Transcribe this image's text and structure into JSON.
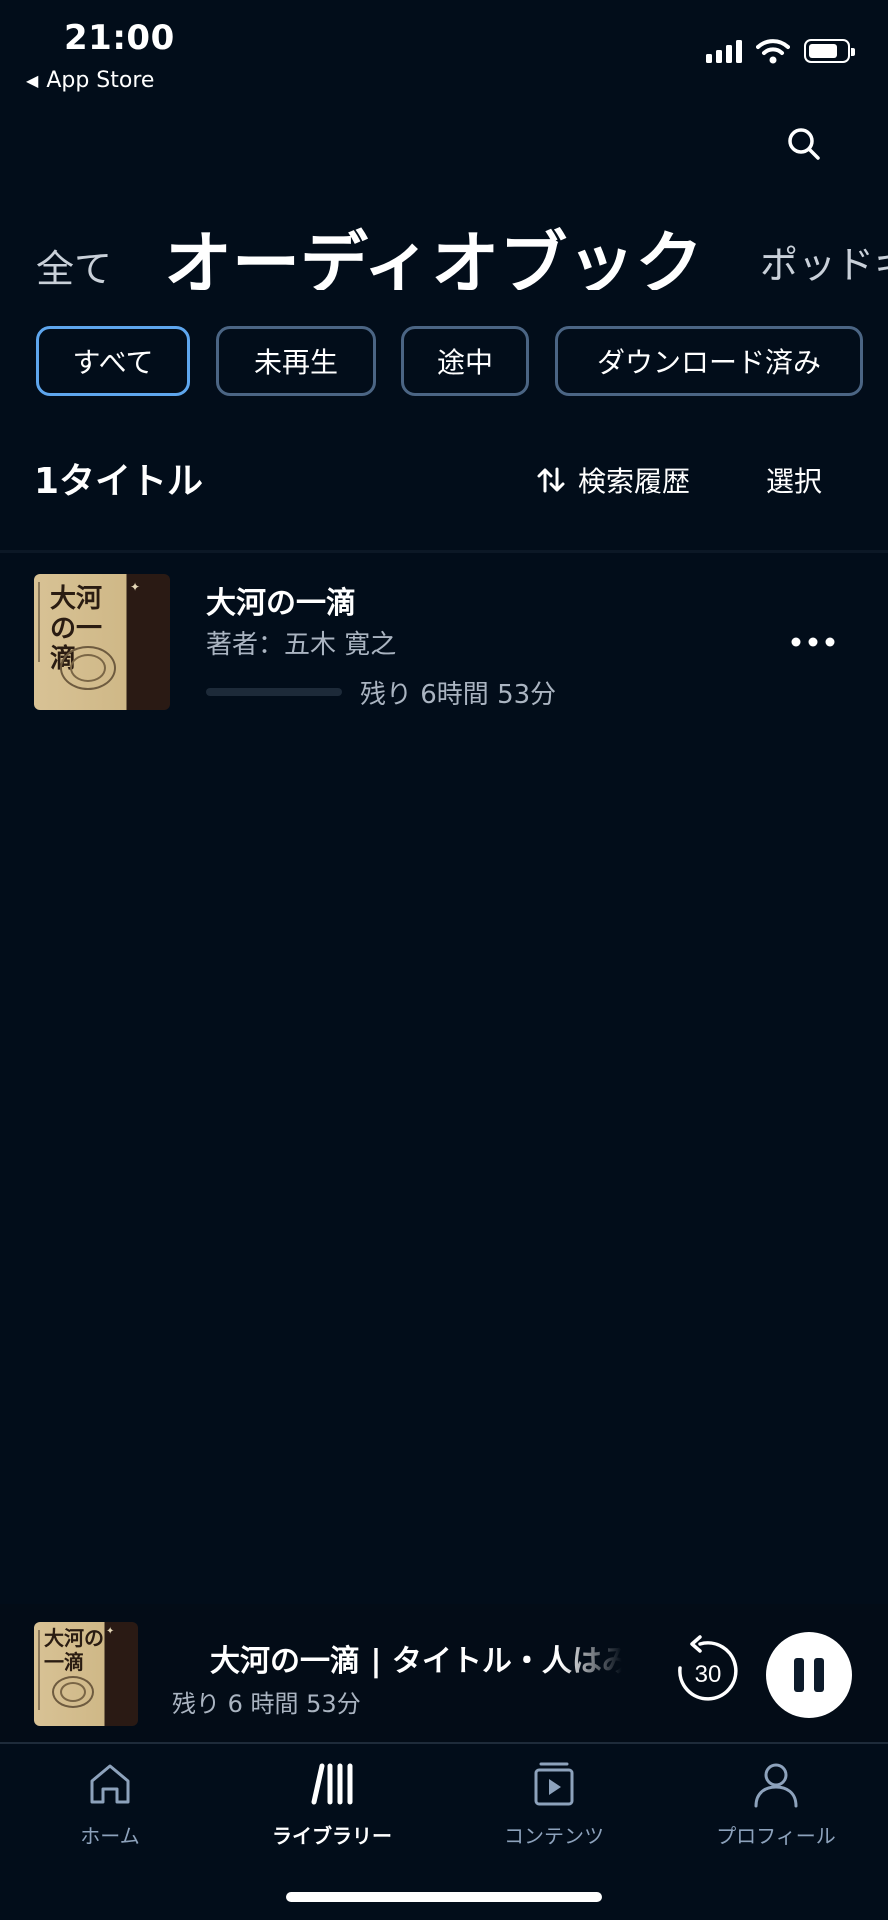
{
  "status_bar": {
    "time": "21:00",
    "back_app": "App Store"
  },
  "category_tabs": {
    "left": "全て",
    "active": "オーディオブック",
    "right": "ポッドキ"
  },
  "filters": [
    "すべて",
    "未再生",
    "途中",
    "ダウンロード済み"
  ],
  "active_filter": "すべて",
  "list_header": {
    "count": "1タイトル",
    "sort_label": "検索履歴",
    "select_label": "選択"
  },
  "books": [
    {
      "title": "大河の一滴",
      "author": "著者：五木 寛之",
      "remaining": "残り 6時間 53分",
      "cover_text": "大河の一滴"
    }
  ],
  "mini_player": {
    "title": "大河の一滴 | タイトル・人はみ",
    "subtitle": "残り 6 時間 53分",
    "skip_back_seconds": "30"
  },
  "tabs": [
    {
      "label": "ホーム",
      "icon": "home-icon"
    },
    {
      "label": "ライブラリー",
      "icon": "library-icon"
    },
    {
      "label": "コンテンツ",
      "icon": "content-icon"
    },
    {
      "label": "プロフィール",
      "icon": "profile-icon"
    }
  ],
  "active_tab": "ライブラリー",
  "colors": {
    "background": "#020d1a",
    "accent": "#5ea6ee",
    "chip_border": "#4b6584",
    "muted_text": "#aab4c1",
    "tab_inactive": "#8da2bc"
  }
}
